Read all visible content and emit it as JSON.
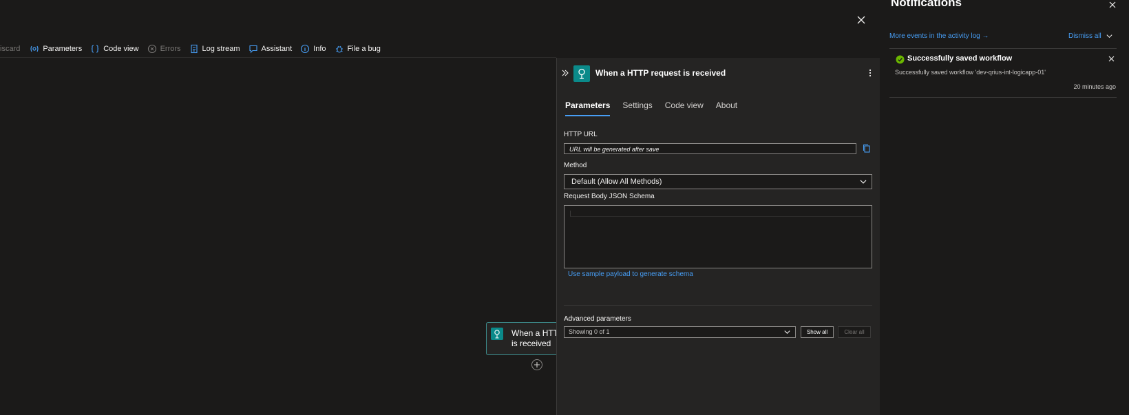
{
  "toolbar": {
    "discard": "iscard",
    "parameters": "Parameters",
    "code_view": "Code view",
    "errors": "Errors",
    "log_stream": "Log stream",
    "assistant": "Assistant",
    "info": "Info",
    "file_bug": "File a bug"
  },
  "canvas": {
    "node_line1": "When a HTTP",
    "node_line2": "is received"
  },
  "panel": {
    "title": "When a HTTP request is received",
    "tabs": [
      "Parameters",
      "Settings",
      "Code view",
      "About"
    ],
    "active_tab": "Parameters",
    "http_url_label": "HTTP URL",
    "http_url_value": "URL will be generated after save",
    "method_label": "Method",
    "method_value": "Default (Allow All Methods)",
    "schema_label": "Request Body JSON Schema",
    "sample_link": "Use sample payload to generate schema",
    "advanced_label": "Advanced parameters",
    "advanced_value": "Showing 0 of 1",
    "show_all": "Show all",
    "clear_all": "Clear all"
  },
  "notifications": {
    "title": "Notifications",
    "more_events": "More events in the activity log →",
    "dismiss_all": "Dismiss all",
    "item": {
      "title": "Successfully saved workflow",
      "body": "Successfully saved workflow 'dev-qrius-int-logicapp-01'",
      "time": "20 minutes ago"
    }
  },
  "colors": {
    "accent": "#479ef5",
    "teal": "#0b8a8a",
    "success": "#6bb700",
    "background": "#1b1a19",
    "panel": "#252423"
  }
}
